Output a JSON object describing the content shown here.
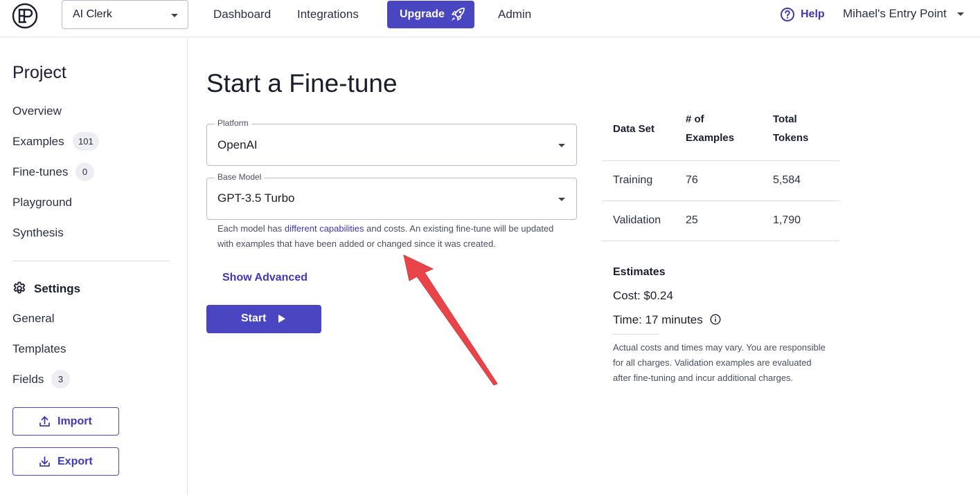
{
  "topbar": {
    "project_selector": "AI Clerk",
    "nav": [
      "Dashboard",
      "Integrations",
      "Admin"
    ],
    "upgrade_label": "Upgrade",
    "help_label": "Help",
    "user_menu": "Mihael's Entry Point",
    "logo_icon": "ep-logo-icon"
  },
  "sidebar": {
    "heading": "Project",
    "items": [
      {
        "label": "Overview"
      },
      {
        "label": "Examples",
        "badge": "101"
      },
      {
        "label": "Fine-tunes",
        "badge": "0"
      },
      {
        "label": "Playground"
      },
      {
        "label": "Synthesis"
      }
    ],
    "settings_heading": "Settings",
    "settings_items": [
      {
        "label": "General"
      },
      {
        "label": "Templates"
      },
      {
        "label": "Fields",
        "badge": "3"
      }
    ],
    "import_label": "Import",
    "export_label": "Export"
  },
  "main": {
    "title": "Start a Fine-tune",
    "platform": {
      "label": "Platform",
      "value": "OpenAI"
    },
    "base_model": {
      "label": "Base Model",
      "value": "GPT-3.5 Turbo"
    },
    "helper_prefix": "Each model has ",
    "helper_link": "different capabilities",
    "helper_suffix": " and costs. An existing fine-tune will be updated with examples that have been added or changed since it was created.",
    "show_advanced": "Show Advanced",
    "start_label": "Start"
  },
  "stats": {
    "headers": [
      "Data Set",
      "# of",
      "Examples",
      "Total",
      "Tokens"
    ],
    "rows": [
      {
        "set": "Training",
        "examples": "76",
        "tokens": "5,584"
      },
      {
        "set": "Validation",
        "examples": "25",
        "tokens": "1,790"
      }
    ]
  },
  "estimates": {
    "title": "Estimates",
    "cost": "Cost: $0.24",
    "time": "Time: 17 minutes",
    "disclaimer": "Actual costs and times may vary. You are responsible for all charges. Validation examples are evaluated after fine-tuning and incur additional charges."
  },
  "colors": {
    "accent": "#4a45c1",
    "annotation_arrow": "#e8454a"
  }
}
